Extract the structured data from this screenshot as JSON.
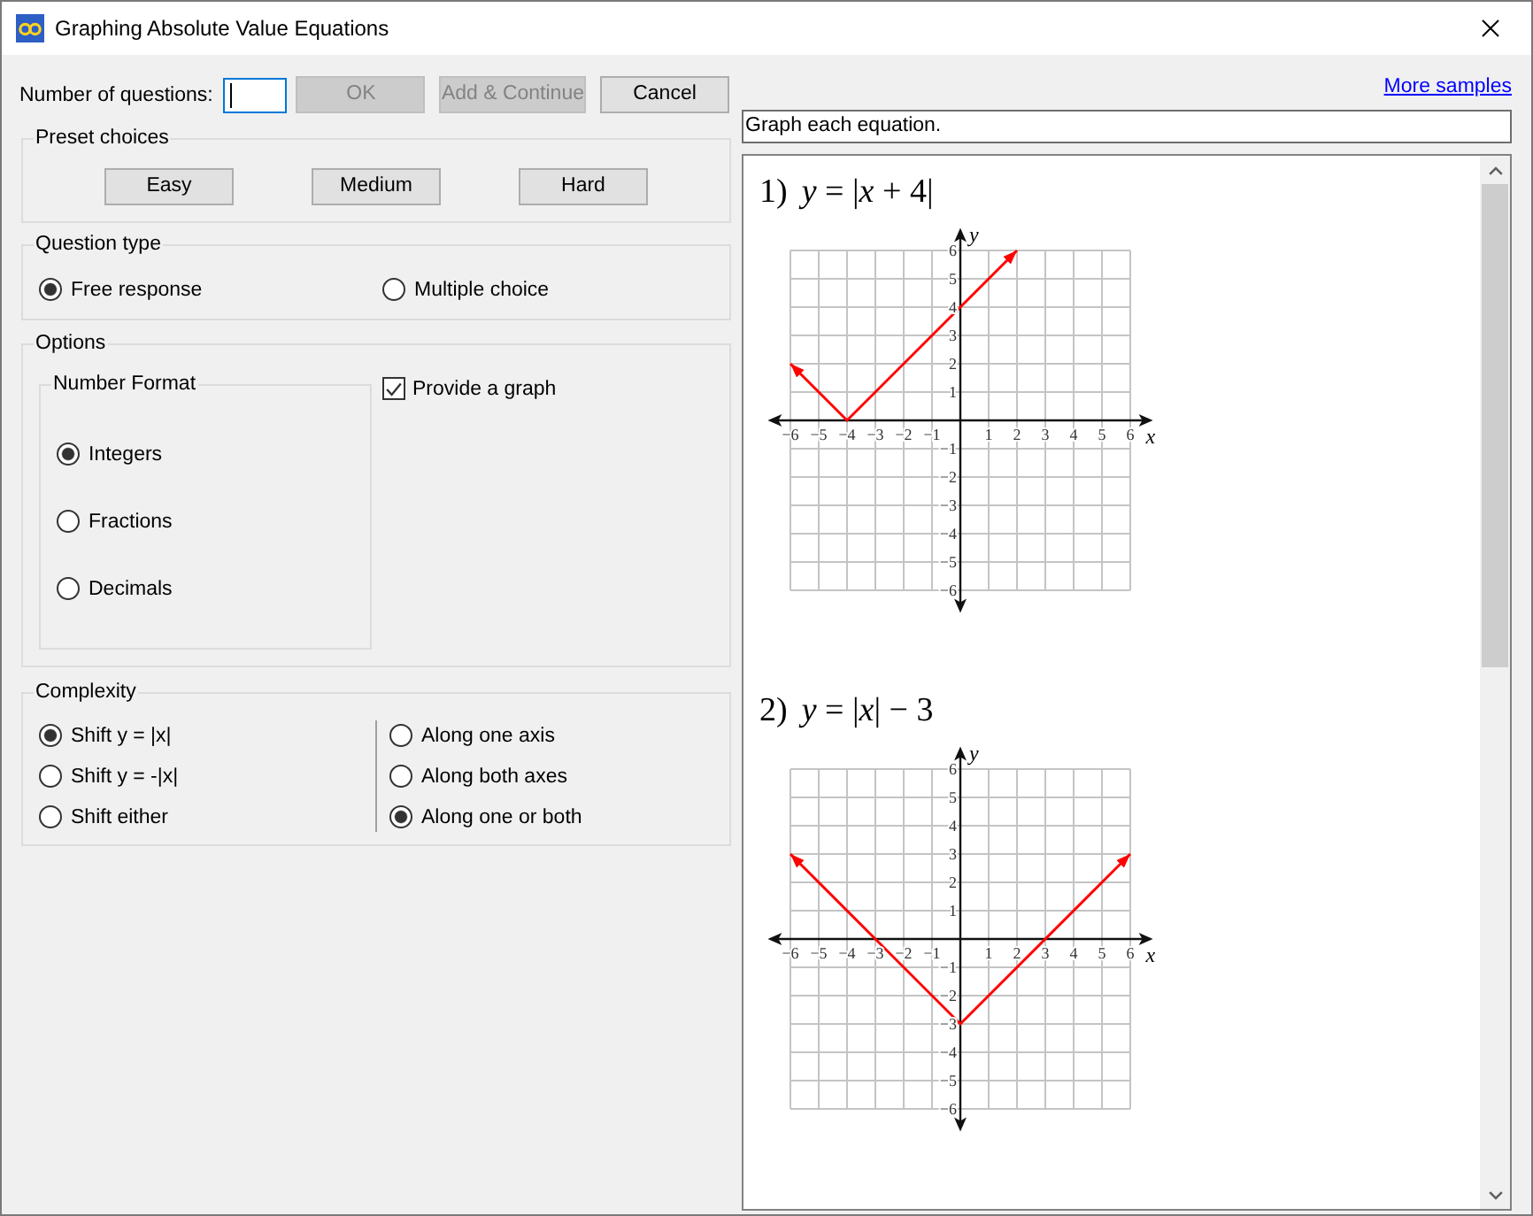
{
  "window": {
    "title": "Graphing Absolute Value Equations"
  },
  "settings": {
    "number_of_questions": {
      "label": "Number of questions:",
      "focused": true
    },
    "buttons": [
      {
        "label": "OK",
        "disabled": true
      },
      {
        "label": "Add & Continue",
        "disabled": true
      },
      {
        "label": "Cancel",
        "disabled": false
      }
    ],
    "preset_choices": {
      "title": "Preset choices",
      "buttons": [
        "Easy",
        "Medium",
        "Hard"
      ]
    },
    "question_type": {
      "title": "Question type",
      "options": [
        {
          "label": "Free response",
          "selected": true
        },
        {
          "label": "Multiple choice",
          "selected": false
        }
      ]
    },
    "options": {
      "title": "Options",
      "number_format": {
        "title": "Number Format",
        "options": [
          {
            "label": "Integers",
            "selected": true
          },
          {
            "label": "Fractions",
            "selected": false
          },
          {
            "label": "Decimals",
            "selected": false
          }
        ]
      },
      "provide_graph": {
        "label": "Provide a graph",
        "checked": true
      }
    },
    "complexity": {
      "title": "Complexity",
      "columns": [
        {
          "options": [
            {
              "label": "Shift y = |x|",
              "selected": true
            },
            {
              "label": "Shift y = -|x|",
              "selected": false
            },
            {
              "label": "Shift either",
              "selected": false
            }
          ]
        },
        {
          "options": [
            {
              "label": "Along one axis",
              "selected": false
            },
            {
              "label": "Along both axes",
              "selected": false
            },
            {
              "label": "Along one or both",
              "selected": true
            }
          ]
        }
      ]
    }
  },
  "preview": {
    "more_samples_link": "More samples",
    "instructions": "Graph each equation.",
    "questions": [
      {
        "number": "1)",
        "equation": "*y* = |*x* + 4|",
        "chart_data": {
          "type": "line",
          "xlabel": "x",
          "ylabel": "y",
          "x": [
            -6,
            -4,
            2
          ],
          "series": [
            {
              "color": "#ff0000",
              "values": [
                2,
                0,
                6
              ]
            }
          ],
          "xlim": [
            -6,
            6
          ],
          "ylim": [
            -6,
            6
          ],
          "grid": true,
          "xticks": [
            {
              "value": -6,
              "label": "−6"
            },
            {
              "value": -5,
              "label": "−5"
            },
            {
              "value": -4,
              "label": "−4"
            },
            {
              "value": -3,
              "label": "−3"
            },
            {
              "value": -2,
              "label": "−2"
            },
            {
              "value": -1,
              "label": "−1"
            },
            1,
            2,
            3,
            4,
            5,
            6
          ],
          "yticks": [
            {
              "value": -6,
              "label": "−6"
            },
            {
              "value": -5,
              "label": "−5"
            },
            {
              "value": -4,
              "label": "−4"
            },
            {
              "value": -3,
              "label": "−3"
            },
            {
              "value": -2,
              "label": "−2"
            },
            {
              "value": -1,
              "label": "−1"
            },
            1,
            2,
            3,
            4,
            5,
            6
          ]
        }
      },
      {
        "number": "2)",
        "equation": "*y* = |*x*| − 3",
        "chart_data": {
          "type": "line",
          "xlabel": "x",
          "ylabel": "y",
          "x": [
            -6,
            0,
            6
          ],
          "series": [
            {
              "color": "#ff0000",
              "values": [
                3,
                -3,
                3
              ]
            }
          ],
          "xlim": [
            -6,
            6
          ],
          "ylim": [
            -6,
            6
          ],
          "grid": true,
          "xticks": [
            {
              "value": -6,
              "label": "−6"
            },
            {
              "value": -5,
              "label": "−5"
            },
            {
              "value": -4,
              "label": "−4"
            },
            {
              "value": -3,
              "label": "−3"
            },
            {
              "value": -2,
              "label": "−2"
            },
            {
              "value": -1,
              "label": "−1"
            },
            1,
            2,
            3,
            4,
            5,
            6
          ],
          "yticks": [
            {
              "value": -6,
              "label": "−6"
            },
            {
              "value": -5,
              "label": "−5"
            },
            {
              "value": -4,
              "label": "−4"
            },
            {
              "value": -3,
              "label": "−3"
            },
            {
              "value": -2,
              "label": "−2"
            },
            {
              "value": -1,
              "label": "−1"
            },
            1,
            2,
            3,
            4,
            5,
            6
          ]
        }
      }
    ]
  }
}
